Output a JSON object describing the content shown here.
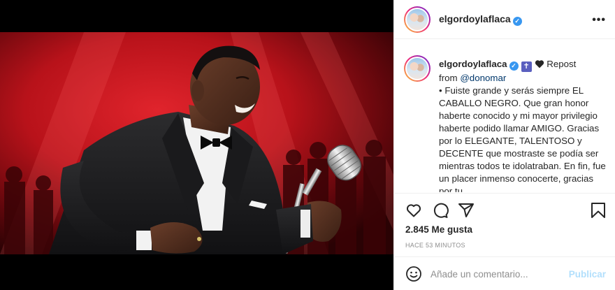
{
  "post": {
    "username": "elgordoylaflaca",
    "verified_icon": "check-icon",
    "more_label": "•••"
  },
  "caption": {
    "username": "elgordoylaflaca",
    "cross_badge": "✝",
    "repost_label": "Repost",
    "from_label": "from",
    "mention": "@donomar",
    "body": "• Fuiste grande y serás siempre EL CABALLO NEGRO. Que gran honor haberte conocido y mi mayor privilegio haberte podido llamar AMIGO. Gracias por lo ELEGANTE, TALENTOSO y DECENTE que mostraste se podía ser mientras todos te idolatraban. En fin, fue un placer inmenso conocerte, gracias por tu"
  },
  "stats": {
    "likes": "2.845 Me gusta",
    "timestamp": "HACE 53 MINUTOS"
  },
  "comment": {
    "placeholder": "Añade un comentario...",
    "publish_label": "Publicar"
  },
  "icons": {
    "like": "heart-icon",
    "comment": "comment-icon",
    "share": "share-icon",
    "save": "bookmark-icon",
    "emoji": "emoji-icon"
  },
  "colors": {
    "verified": "#3897f0",
    "link": "#00376b",
    "publish_disabled": "#b2dffc",
    "muted": "#8e8e8e",
    "stage_red": "#c0141c"
  }
}
